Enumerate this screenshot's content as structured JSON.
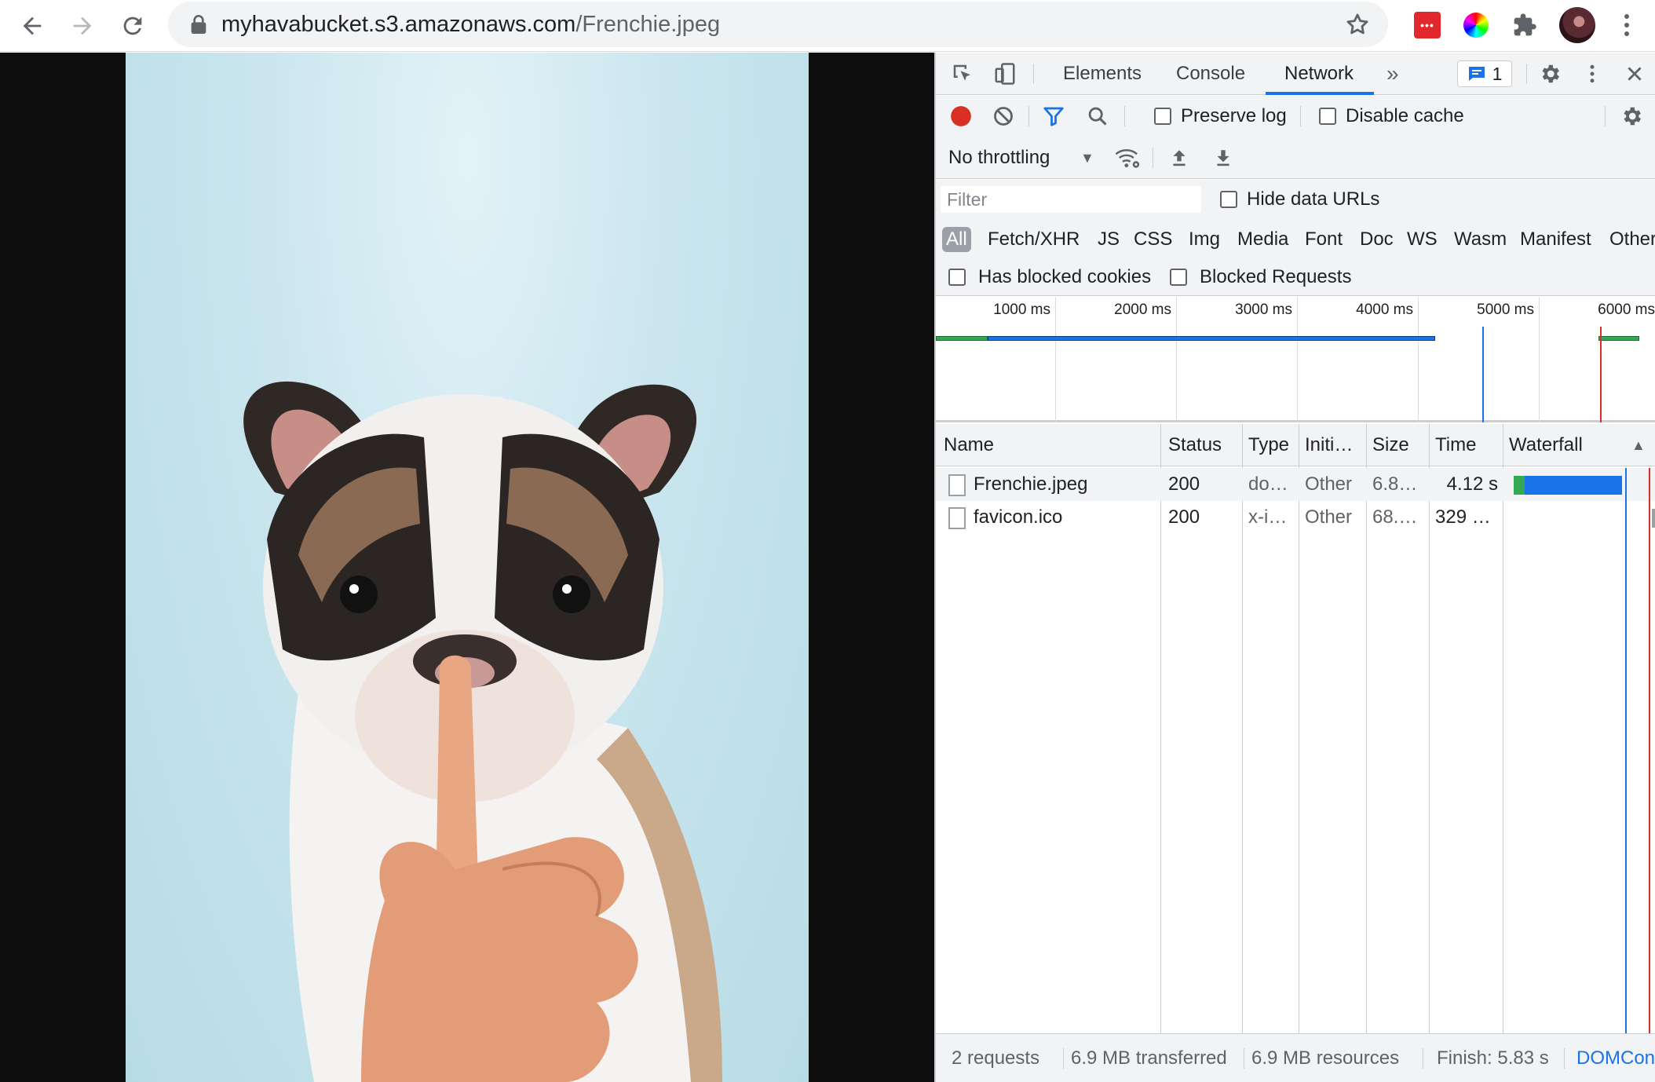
{
  "browser": {
    "url_host": "myhavabucket.s3.amazonaws.com",
    "url_path": "/Frenchie.jpeg",
    "extension_badge": "•••",
    "icons": [
      "back-icon",
      "forward-icon",
      "reload-icon",
      "lock-icon",
      "star-icon",
      "extension-icon",
      "color-picker-icon",
      "puzzle-icon",
      "avatar",
      "more-icon"
    ]
  },
  "devtools": {
    "tabs": [
      {
        "label": "Elements"
      },
      {
        "label": "Console"
      },
      {
        "label": "Network",
        "active": true
      }
    ],
    "more_tabs": "»",
    "issues_count": "1",
    "toolbar": {
      "preserve_log": "Preserve log",
      "disable_cache": "Disable cache",
      "throttling": "No throttling"
    },
    "filter": {
      "placeholder": "Filter",
      "hide_data_urls": "Hide data URLs"
    },
    "type_filters": [
      "All",
      "Fetch/XHR",
      "JS",
      "CSS",
      "Img",
      "Media",
      "Font",
      "Doc",
      "WS",
      "Wasm",
      "Manifest",
      "Other"
    ],
    "blocked": {
      "has_blocked_cookies": "Has blocked cookies",
      "blocked_requests": "Blocked Requests"
    },
    "overview_ticks": [
      "1000 ms",
      "2000 ms",
      "3000 ms",
      "4000 ms",
      "5000 ms",
      "6000 ms"
    ],
    "columns": [
      "Name",
      "Status",
      "Type",
      "Initi…",
      "Size",
      "Time",
      "Waterfall"
    ],
    "sort_indicator": "▲",
    "requests": [
      {
        "name": "Frenchie.jpeg",
        "status": "200",
        "type": "do…",
        "initiator": "Other",
        "size": "6.8…",
        "time": "4.12 s"
      },
      {
        "name": "favicon.ico",
        "status": "200",
        "type": "x-i…",
        "initiator": "Other",
        "size": "68.…",
        "time": "329 …"
      }
    ],
    "statusbar": {
      "requests": "2 requests",
      "transferred": "6.9 MB transferred",
      "resources": "6.9 MB resources",
      "finish": "Finish: 5.83 s",
      "domcontent": "DOMCon"
    },
    "colors": {
      "accent": "#1a73e8",
      "record": "#d93025",
      "waiting": "#34a853",
      "download": "#1a73e8",
      "load_line": "#d93025",
      "dom_line": "#1a73e8"
    }
  }
}
